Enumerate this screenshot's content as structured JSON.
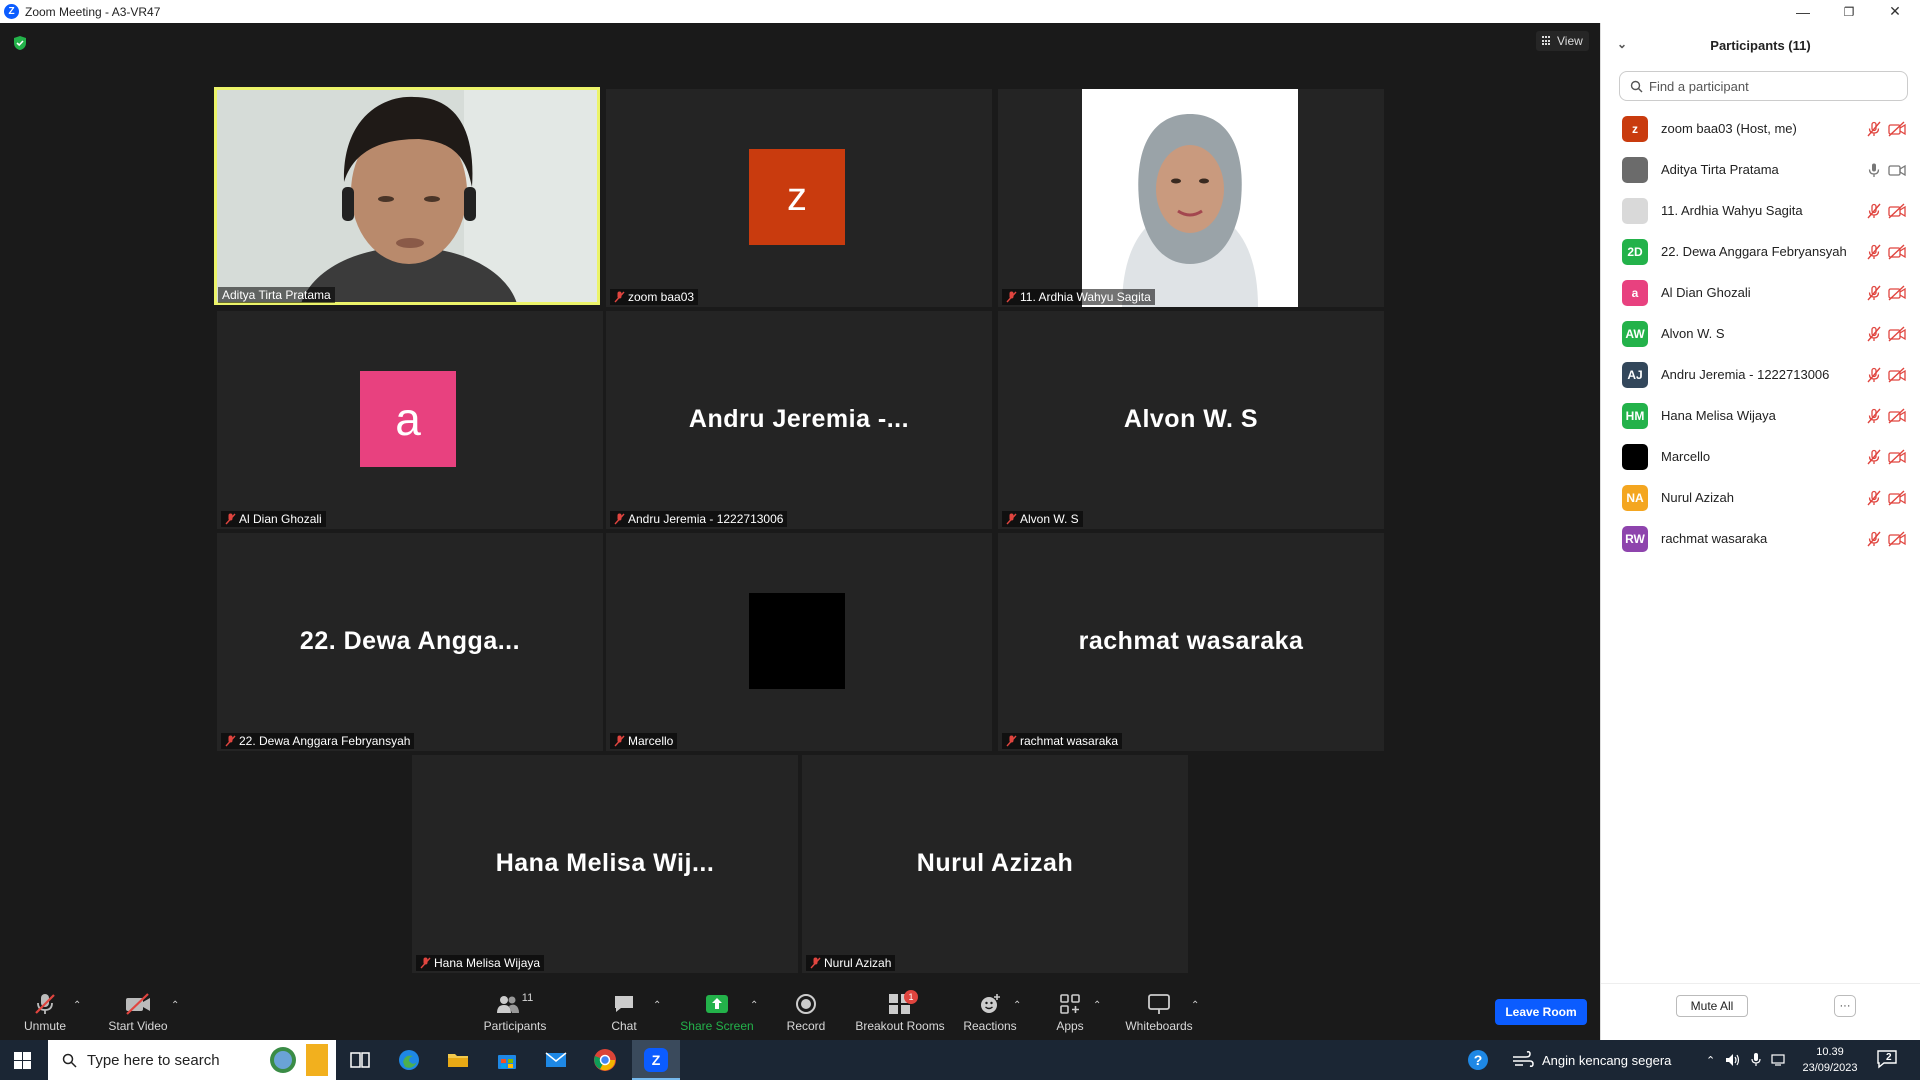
{
  "window": {
    "title": "Zoom Meeting - A3-VR47",
    "minimize": "—",
    "restore": "❐",
    "close": "✕"
  },
  "view_label": "View",
  "tiles": [
    {
      "name": "Aditya Tirta Pratama",
      "kind": "video",
      "active": true
    },
    {
      "name": "zoom baa03",
      "kind": "avatar",
      "avatar_letter": "z",
      "avatar_color": "#c93b0e"
    },
    {
      "name": "11. Ardhia Wahyu Sagita",
      "kind": "photo"
    },
    {
      "name": "Al Dian Ghozali",
      "kind": "avatar",
      "avatar_letter": "a",
      "avatar_color": "#e8417f"
    },
    {
      "name": "Andru Jeremia - 1222713006",
      "kind": "text",
      "display": "Andru Jeremia -..."
    },
    {
      "name": "Alvon W. S",
      "kind": "text",
      "display": "Alvon W. S"
    },
    {
      "name": "22. Dewa Anggara Febryansyah",
      "kind": "text",
      "display": "22. Dewa Angga..."
    },
    {
      "name": "Marcello",
      "kind": "avatar",
      "avatar_letter": "",
      "avatar_color": "#000000"
    },
    {
      "name": "rachmat wasaraka",
      "kind": "text",
      "display": "rachmat wasaraka"
    },
    {
      "name": "Hana Melisa Wijaya",
      "kind": "text",
      "display": "Hana Melisa Wij..."
    },
    {
      "name": "Nurul Azizah",
      "kind": "text",
      "display": "Nurul Azizah"
    }
  ],
  "toolbar": {
    "unmute": "Unmute",
    "start_video": "Start Video",
    "participants": "Participants",
    "participants_count": "11",
    "chat": "Chat",
    "share_screen": "Share Screen",
    "record": "Record",
    "breakout_rooms": "Breakout Rooms",
    "breakout_badge": "1",
    "reactions": "Reactions",
    "apps": "Apps",
    "whiteboards": "Whiteboards",
    "leave_room": "Leave Room"
  },
  "panel": {
    "title": "Participants (11)",
    "search_placeholder": "Find a participant",
    "mute_all": "Mute All",
    "more": "···",
    "participants": [
      {
        "name": "zoom baa03 (Host, me)",
        "initials": "z",
        "color": "#c93b0e",
        "mic": "off",
        "cam": "off"
      },
      {
        "name": "Aditya Tirta Pratama",
        "initials": "",
        "color": "#6b6b6b",
        "mic": "on",
        "cam": "on"
      },
      {
        "name": "11. Ardhia Wahyu Sagita",
        "initials": "",
        "color": "#d9d9d9",
        "mic": "off",
        "cam": "off"
      },
      {
        "name": "22. Dewa Anggara Febryansyah",
        "initials": "2D",
        "color": "#23b24a",
        "mic": "off",
        "cam": "off"
      },
      {
        "name": "Al Dian Ghozali",
        "initials": "a",
        "color": "#e8417f",
        "mic": "off",
        "cam": "off"
      },
      {
        "name": "Alvon W. S",
        "initials": "AW",
        "color": "#23b24a",
        "mic": "off",
        "cam": "off"
      },
      {
        "name": "Andru Jeremia - 1222713006",
        "initials": "AJ",
        "color": "#33475b",
        "mic": "off",
        "cam": "off"
      },
      {
        "name": "Hana Melisa Wijaya",
        "initials": "HM",
        "color": "#23b24a",
        "mic": "off",
        "cam": "off"
      },
      {
        "name": "Marcello",
        "initials": "",
        "color": "#000000",
        "mic": "off",
        "cam": "off"
      },
      {
        "name": "Nurul Azizah",
        "initials": "NA",
        "color": "#f4a620",
        "mic": "off",
        "cam": "off"
      },
      {
        "name": "rachmat wasaraka",
        "initials": "RW",
        "color": "#8e44ad",
        "mic": "off",
        "cam": "off"
      }
    ]
  },
  "taskbar": {
    "search_placeholder": "Type here to search",
    "weather": "Angin kencang segera",
    "time": "10.39",
    "date": "23/09/2023",
    "notification_count": "2"
  }
}
